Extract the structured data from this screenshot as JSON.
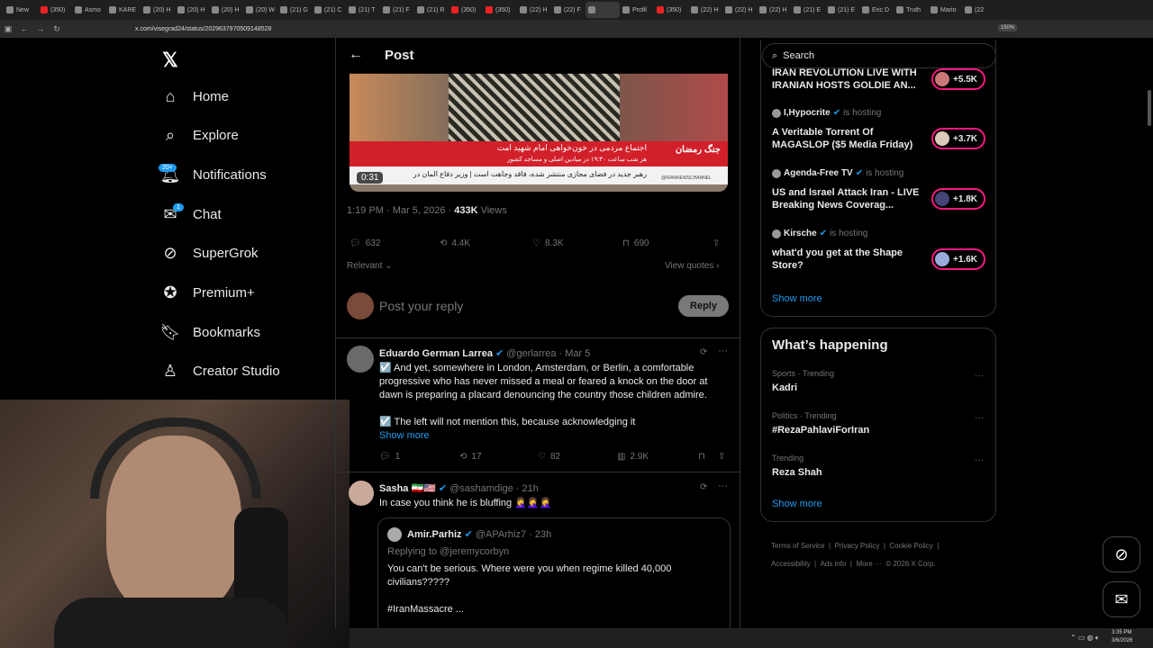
{
  "browser": {
    "tabs": [
      "New",
      "(350)",
      "Asmo",
      "KARE",
      "(20) H",
      "(20) H",
      "(20) H",
      "(20) W",
      "(21) G",
      "(21) C",
      "(21) T",
      "(21) F",
      "(21) R",
      "(350)",
      "(350)",
      "(22) H",
      "(22) F",
      "",
      "Profil",
      "(350)",
      "(22) H",
      "(22) H",
      "(22) H",
      "(21) E",
      "(21) E",
      "Eric D",
      "Truth",
      "Mario",
      "(22"
    ],
    "url": "x.com/visegrad24/status/2029637970509148528",
    "zoom": "150%"
  },
  "sidebar": {
    "items": [
      {
        "label": "Home",
        "icon": "home-icon"
      },
      {
        "label": "Explore",
        "icon": "search-icon"
      },
      {
        "label": "Notifications",
        "icon": "bell-icon"
      },
      {
        "label": "Chat",
        "icon": "mail-icon"
      },
      {
        "label": "SuperGrok",
        "icon": "grok-icon"
      },
      {
        "label": "Premium+",
        "icon": "verified-icon"
      },
      {
        "label": "Bookmarks",
        "icon": "bookmark-icon"
      },
      {
        "label": "Creator Studio",
        "icon": "creator-icon"
      }
    ],
    "notifications_badge": "20+",
    "chat_badge": "1"
  },
  "post": {
    "header_title": "Post",
    "video_time": "0:31",
    "video_caption_1": "اجتماع مردمی در خون‌خواهی امام شهید امت",
    "video_caption_2": "هر شب ساعت ۱۹:۳۰ در میادین اصلی و مساجد کشور",
    "video_caption_3": "رهبر جدید در فضای مجازی منتشر شده، فاقد وجاهت است  |  وزیر دفاع آلمان در",
    "video_badge": "جنگ رمضان",
    "channel": "@IRANNEWSCHANNEL",
    "timestamp": "1:19 PM · Mar 5, 2026 ·",
    "views_count": "433K",
    "views_label": "Views",
    "replies": "632",
    "reposts": "4.4K",
    "likes": "8.3K",
    "bookmarks": "690",
    "sort_label": "Relevant",
    "view_quotes": "View quotes",
    "reply_placeholder": "Post your reply",
    "reply_button": "Reply"
  },
  "replies": [
    {
      "name": "Eduardo German Larrea",
      "handle": "@gerlarrea · Mar 5",
      "text1": "☑️ And yet, somewhere in London, Amsterdam, or Berlin, a comfortable progressive who has never missed a meal or feared a knock on the door at dawn is preparing a placard denouncing the country those children admire.",
      "text2": "☑️ The left will not mention this, because acknowledging it",
      "show_more": "Show more",
      "replies": "1",
      "reposts": "17",
      "likes": "82",
      "views": "2.9K"
    },
    {
      "name": "Sasha 🇮🇷🇺🇸",
      "handle": "@sashamdige · 21h",
      "text": "In case you think he is bluffing 🤦‍♀️🤦‍♀️🤦‍♀️",
      "quote_name": "Amir.Parhiz",
      "quote_handle": "@APArhiz7 · 23h",
      "quote_replying": "Replying to @jeremycorbyn",
      "quote_text": "You can't  be serious.  Where were you when regime killed  40,000 civilians?????",
      "quote_tag": "#IranMassacre ..."
    }
  ],
  "right": {
    "search_placeholder": "Search",
    "live": [
      {
        "title": "IRAN REVOLUTION LIVE WITH IRANIAN HOSTS GOLDIE AN...",
        "count": "+5.5K"
      },
      {
        "host": "I,Hypocrite",
        "hosting": "is hosting",
        "title": "A Veritable Torrent Of MAGASLOP ($5 Media Friday)",
        "count": "+3.7K"
      },
      {
        "host": "Agenda-Free TV",
        "hosting": "is hosting",
        "title": "US and Israel Attack Iran - LIVE Breaking News Coverag...",
        "count": "+1.8K"
      },
      {
        "host": "Kirsche",
        "hosting": "is hosting",
        "title": "what'd you get at the Shape Store?",
        "count": "+1.6K"
      }
    ],
    "show_more_1": "Show more",
    "happening_title": "What’s happening",
    "trends": [
      {
        "category": "Sports · Trending",
        "name": "Kadri"
      },
      {
        "category": "Politics · Trending",
        "name": "#RezaPahlaviForIran"
      },
      {
        "category": "Trending",
        "name": "Reza Shah"
      }
    ],
    "show_more_2": "Show more",
    "footer": [
      "Terms of Service",
      "Privacy Policy",
      "Cookie Policy",
      "Accessibility",
      "Ads info",
      "More ···",
      "© 2026 X Corp."
    ]
  },
  "taskbar": {
    "time": "3:35 PM",
    "date": "3/6/2026"
  },
  "colors": {
    "accent": "#1d9bf0",
    "live": "#f91880",
    "video_red": "#d2202a"
  }
}
